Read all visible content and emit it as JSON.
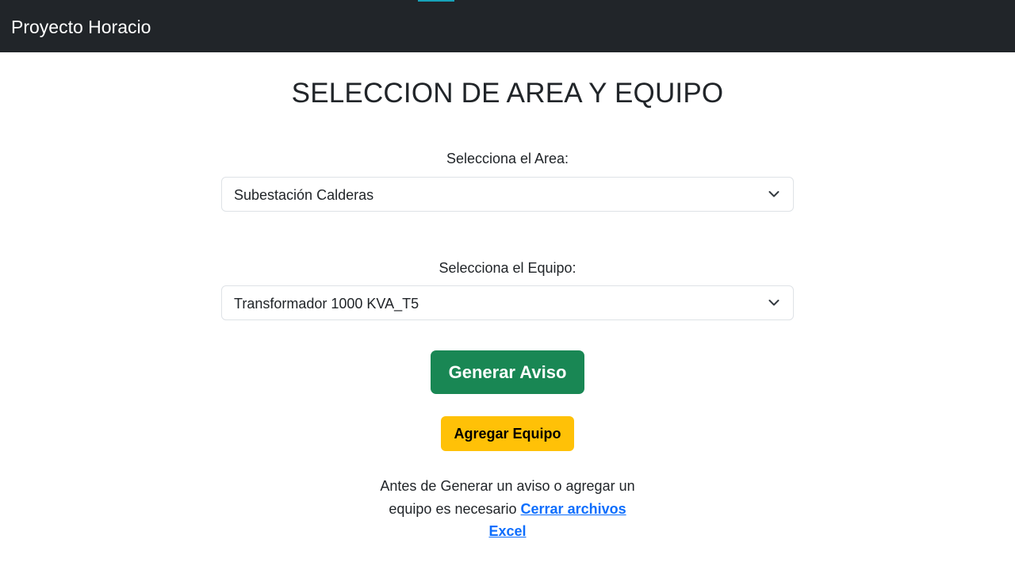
{
  "navbar": {
    "brand": "Proyecto Horacio"
  },
  "page": {
    "title": "SELECCION DE AREA Y EQUIPO"
  },
  "area": {
    "label": "Selecciona el Area:",
    "selected": "Subestación Calderas"
  },
  "equipo": {
    "label": "Selecciona el Equipo:",
    "selected": "Transformador 1000 KVA_T5"
  },
  "buttons": {
    "generate_label": "Generar Aviso",
    "add_label": "Agregar Equipo"
  },
  "notice": {
    "line1": "Antes de Generar un aviso o agregar un",
    "line2_prefix": "equipo es necesario",
    "link_part1": "Cerrar archivos",
    "link_part2": "Excel"
  },
  "colors": {
    "navbar_bg": "#212529",
    "nav_accent": "#17a2b8",
    "generate_button": "#198754",
    "add_button": "#ffc107",
    "link": "#0d6efd"
  },
  "icons": {
    "select_arrow": "chevron-down-icon"
  }
}
